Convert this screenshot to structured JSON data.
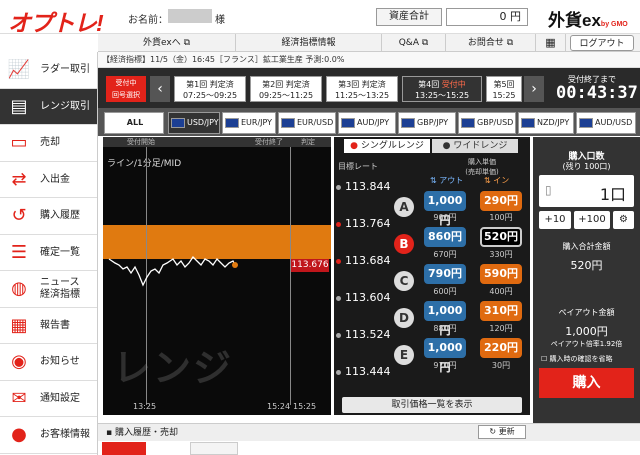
{
  "header": {
    "logo": "オプトレ!",
    "name_label": "お名前：",
    "name_suffix": "様",
    "asset_label": "資産合計",
    "asset_value": "0 円",
    "brand": "外貨ex",
    "brand_sub": "by GMO"
  },
  "nav": {
    "items": [
      "外貨exへ ⧉",
      "経済指標情報",
      "Q&A ⧉",
      "お問合せ ⧉"
    ],
    "logout": "ログアウト"
  },
  "ticker": "【経済指標】11/5（金）16:45［フランス］鉱工業生産 予測:0.0%",
  "sidebar": {
    "items": [
      {
        "label": "ラダー取引",
        "icon": "ladder-chart-icon"
      },
      {
        "label": "レンジ取引",
        "icon": "range-chart-icon"
      },
      {
        "label": "売却",
        "icon": "sell-icon"
      },
      {
        "label": "入出金",
        "icon": "transfer-icon"
      },
      {
        "label": "購入履歴",
        "icon": "history-icon"
      },
      {
        "label": "確定一覧",
        "icon": "list-icon"
      },
      {
        "label": "ニュース\n経済指標",
        "icon": "globe-icon"
      },
      {
        "label": "報告書",
        "icon": "report-icon"
      },
      {
        "label": "お知らせ",
        "icon": "notice-icon"
      },
      {
        "label": "通知設定",
        "icon": "mail-icon"
      },
      {
        "label": "お客様情報",
        "icon": "user-icon"
      }
    ]
  },
  "rounds": {
    "live_label": "受付中\n回号選択",
    "items": [
      {
        "title": "第1回 判定済",
        "time": "07:25〜09:25"
      },
      {
        "title": "第2回 判定済",
        "time": "09:25〜11:25"
      },
      {
        "title": "第3回 判定済",
        "time": "11:25〜13:25"
      },
      {
        "title": "第4回",
        "status": "受付中",
        "time": "13:25〜15:25"
      },
      {
        "title": "第5回",
        "time": "15:25"
      }
    ],
    "countdown_label": "受付終了まで",
    "countdown": "00:43:37"
  },
  "pairs": [
    "ALL",
    "USD/JPY",
    "EUR/JPY",
    "EUR/USD",
    "AUD/JPY",
    "GBP/JPY",
    "GBP/USD",
    "NZD/JPY",
    "AUD/USD"
  ],
  "chart": {
    "top_labels": [
      "受付開始",
      "受付終了",
      "判定"
    ],
    "title": "ライン/1分足/MID",
    "watermark": "レンジ",
    "price": "113.676",
    "x_ticks": [
      "13:25",
      "15:24",
      "15:25"
    ]
  },
  "rate": {
    "tab_single": "シングルレンジ",
    "tab_wide": "ワイドレンジ",
    "target_label": "目標レート",
    "unit_label": "購入単価\n(売却単価)",
    "out_label": "アウト",
    "in_label": "イン",
    "levels": [
      "113.844",
      "113.764",
      "113.684",
      "113.604",
      "113.524",
      "113.444"
    ],
    "rows": [
      {
        "label": "A",
        "out": "1,000円",
        "out_sub": "900円",
        "in": "290円",
        "in_sub": "100円"
      },
      {
        "label": "B",
        "out": "860円",
        "out_sub": "670円",
        "in": "520円",
        "in_sub": "330円"
      },
      {
        "label": "C",
        "out": "790円",
        "out_sub": "600円",
        "in": "590円",
        "in_sub": "400円"
      },
      {
        "label": "D",
        "out": "1,000円",
        "out_sub": "880円",
        "in": "310円",
        "in_sub": "120円"
      },
      {
        "label": "E",
        "out": "1,000円",
        "out_sub": "970円",
        "in": "220円",
        "in_sub": "30円"
      }
    ],
    "show_list": "取引価格一覧を表示"
  },
  "order": {
    "qty_label": "購入口数",
    "qty_sub": "(残り 100口)",
    "qty_value": "1口",
    "plus10": "+10",
    "plus100": "+100",
    "total_label": "購入合計金額",
    "total_value": "520円",
    "payout_label": "ペイアウト金額",
    "payout_value": "1,000円",
    "payout_rate": "ペイアウト倍率1.92倍",
    "confirm_label": "購入時の確認を省略",
    "buy": "購入"
  },
  "history": {
    "title": "購入履歴・売却",
    "refresh": "更新"
  }
}
